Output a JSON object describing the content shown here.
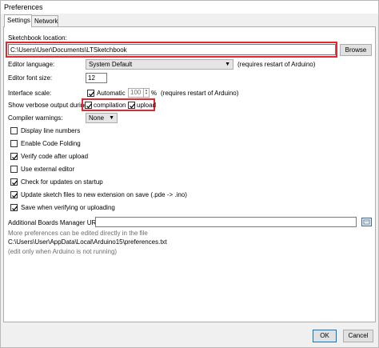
{
  "window": {
    "title": "Preferences"
  },
  "tabs": [
    {
      "label": "Settings",
      "active": true
    },
    {
      "label": "Network",
      "active": false
    }
  ],
  "sketchbook": {
    "label": "Sketchbook location:",
    "value": "C:\\Users\\User\\Documents\\LTSketchbook",
    "browse_label": "Browse"
  },
  "editor_language": {
    "label": "Editor language:",
    "value": "System Default",
    "note": "(requires restart of Arduino)"
  },
  "font_size": {
    "label": "Editor font size:",
    "value": "12"
  },
  "interface_scale": {
    "label": "Interface scale:",
    "automatic_label": "Automatic",
    "automatic_checked": true,
    "value": "100",
    "unit": "%",
    "note": "(requires restart of Arduino)"
  },
  "verbose": {
    "label": "Show verbose output during:",
    "compilation_label": "compilation",
    "compilation_checked": true,
    "upload_label": "upload",
    "upload_checked": true
  },
  "compiler_warnings": {
    "label": "Compiler warnings:",
    "value": "None"
  },
  "options": [
    {
      "label": "Display line numbers",
      "checked": false
    },
    {
      "label": "Enable Code Folding",
      "checked": false
    },
    {
      "label": "Verify code after upload",
      "checked": true
    },
    {
      "label": "Use external editor",
      "checked": false
    },
    {
      "label": "Check for updates on startup",
      "checked": true
    },
    {
      "label": "Update sketch files to new extension on save (.pde -> .ino)",
      "checked": true
    },
    {
      "label": "Save when verifying or uploading",
      "checked": true
    }
  ],
  "boards_manager": {
    "label": "Additional Boards Manager URLs:",
    "value": ""
  },
  "more_prefs": {
    "text": "More preferences can be edited directly in the file",
    "path": "C:\\Users\\User\\AppData\\Local\\Arduino15\\preferences.txt",
    "note": "(edit only when Arduino is not running)"
  },
  "footer": {
    "ok_label": "OK",
    "cancel_label": "Cancel"
  },
  "colors": {
    "highlight": "#e8262d",
    "check": "#000000"
  }
}
